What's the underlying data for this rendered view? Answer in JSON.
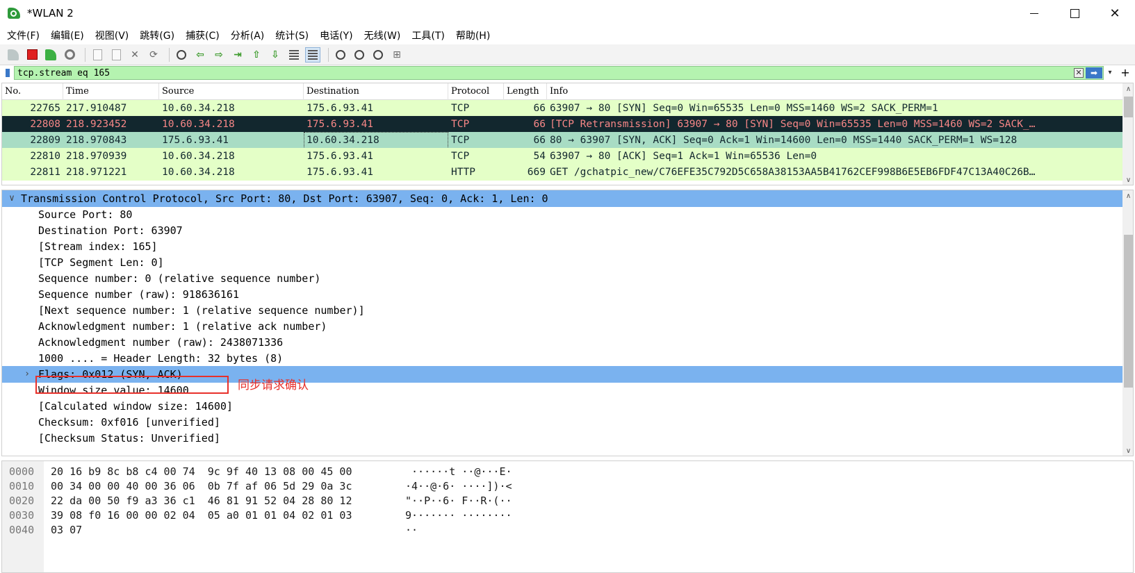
{
  "window": {
    "title": "*WLAN 2",
    "minimize_glyph": "",
    "maximize_glyph": "",
    "close_glyph": "✕"
  },
  "menu": [
    "文件(F)",
    "编辑(E)",
    "视图(V)",
    "跳转(G)",
    "捕获(C)",
    "分析(A)",
    "统计(S)",
    "电话(Y)",
    "无线(W)",
    "工具(T)",
    "帮助(H)"
  ],
  "toolbar": {
    "icons": [
      "shark-fin-icon",
      "stop-capture-icon",
      "restart-capture-icon",
      "capture-options-icon",
      "open-file-icon",
      "save-file-icon",
      "close-file-icon",
      "reload-file-icon",
      "find-packet-icon",
      "go-back-icon",
      "go-forward-icon",
      "go-to-packet-icon",
      "go-first-icon",
      "go-last-icon",
      "autoscroll-icon",
      "colorize-icon",
      "zoom-in-icon",
      "zoom-out-icon",
      "zoom-normal-icon",
      "resize-columns-icon"
    ]
  },
  "filter": {
    "value": "tcp.stream eq 165",
    "clear_glyph": "✕",
    "apply_glyph": "➡",
    "dropdown_glyph": "▾",
    "add_glyph": "+"
  },
  "packet_list": {
    "columns": [
      "No.",
      "Time",
      "Source",
      "Destination",
      "Protocol",
      "Length",
      "Info"
    ],
    "rows": [
      {
        "no": "22765",
        "time": "217.910487",
        "src": "10.60.34.218",
        "dst": "175.6.93.41",
        "proto": "TCP",
        "len": "66",
        "info": "63907 → 80 [SYN] Seq=0 Win=65535 Len=0 MSS=1460 WS=2 SACK_PERM=1",
        "style": "green"
      },
      {
        "no": "22808",
        "time": "218.923452",
        "src": "10.60.34.218",
        "dst": "175.6.93.41",
        "proto": "TCP",
        "len": "66",
        "info": "[TCP Retransmission] 63907 → 80 [SYN] Seq=0 Win=65535 Len=0 MSS=1460 WS=2 SACK_…",
        "style": "black"
      },
      {
        "no": "22809",
        "time": "218.970843",
        "src": "175.6.93.41",
        "dst": "10.60.34.218",
        "proto": "TCP",
        "len": "66",
        "info": "80 → 63907 [SYN, ACK] Seq=0 Ack=1 Win=14600 Len=0 MSS=1440 SACK_PERM=1 WS=128",
        "style": "selected"
      },
      {
        "no": "22810",
        "time": "218.970939",
        "src": "10.60.34.218",
        "dst": "175.6.93.41",
        "proto": "TCP",
        "len": "54",
        "info": "63907 → 80 [ACK] Seq=1 Ack=1 Win=65536 Len=0",
        "style": "green"
      },
      {
        "no": "22811",
        "time": "218.971221",
        "src": "10.60.34.218",
        "dst": "175.6.93.41",
        "proto": "HTTP",
        "len": "669",
        "info": "GET /gchatpic_new/C76EFE35C792D5C658A38153AA5B41762CEF998B6E5EB6FDF47C13A40C26B…",
        "style": "green"
      }
    ]
  },
  "details": {
    "lines": [
      {
        "arrow": "∨",
        "text": "Transmission Control Protocol, Src Port: 80, Dst Port: 63907, Seq: 0, Ack: 1, Len: 0",
        "indent": 0,
        "highlight": true
      },
      {
        "arrow": "",
        "text": "Source Port: 80",
        "indent": 1
      },
      {
        "arrow": "",
        "text": "Destination Port: 63907",
        "indent": 1
      },
      {
        "arrow": "",
        "text": "[Stream index: 165]",
        "indent": 1
      },
      {
        "arrow": "",
        "text": "[TCP Segment Len: 0]",
        "indent": 1
      },
      {
        "arrow": "",
        "text": "Sequence number: 0    (relative sequence number)",
        "indent": 1
      },
      {
        "arrow": "",
        "text": "Sequence number (raw): 918636161",
        "indent": 1
      },
      {
        "arrow": "",
        "text": "[Next sequence number: 1    (relative sequence number)]",
        "indent": 1
      },
      {
        "arrow": "",
        "text": "Acknowledgment number: 1    (relative ack number)",
        "indent": 1
      },
      {
        "arrow": "",
        "text": "Acknowledgment number (raw): 2438071336",
        "indent": 1
      },
      {
        "arrow": "",
        "text": "1000 .... = Header Length: 32 bytes (8)",
        "indent": 1
      },
      {
        "arrow": "›",
        "text": "Flags: 0x012 (SYN, ACK)",
        "indent": 1,
        "highlight": true
      },
      {
        "arrow": "",
        "text": "Window size value: 14600",
        "indent": 1
      },
      {
        "arrow": "",
        "text": "[Calculated window size: 14600]",
        "indent": 1
      },
      {
        "arrow": "",
        "text": "Checksum: 0xf016 [unverified]",
        "indent": 1
      },
      {
        "arrow": "",
        "text": "[Checksum Status: Unverified]",
        "indent": 1
      }
    ],
    "annotation": "同步请求确认"
  },
  "bytes": {
    "lines": [
      {
        "offset": "0000",
        "hex": "20 16 b9 8c b8 c4 00 74  9c 9f 40 13 08 00 45 00",
        "ascii": " ······t ··@···E·"
      },
      {
        "offset": "0010",
        "hex": "00 34 00 00 40 00 36 06  0b 7f af 06 5d 29 0a 3c",
        "ascii": "·4··@·6· ····])·<"
      },
      {
        "offset": "0020",
        "hex": "22 da 00 50 f9 a3 36 c1  46 81 91 52 04 28 80 12",
        "ascii": "\"··P··6· F··R·(··"
      },
      {
        "offset": "0030",
        "hex": "39 08 f0 16 00 00 02 04  05 a0 01 01 04 02 01 03",
        "ascii": "9······· ········"
      },
      {
        "offset": "0040",
        "hex": "03 07",
        "ascii": "··"
      }
    ]
  },
  "scroll": {
    "up_glyph": "∧",
    "down_glyph": "∨"
  }
}
